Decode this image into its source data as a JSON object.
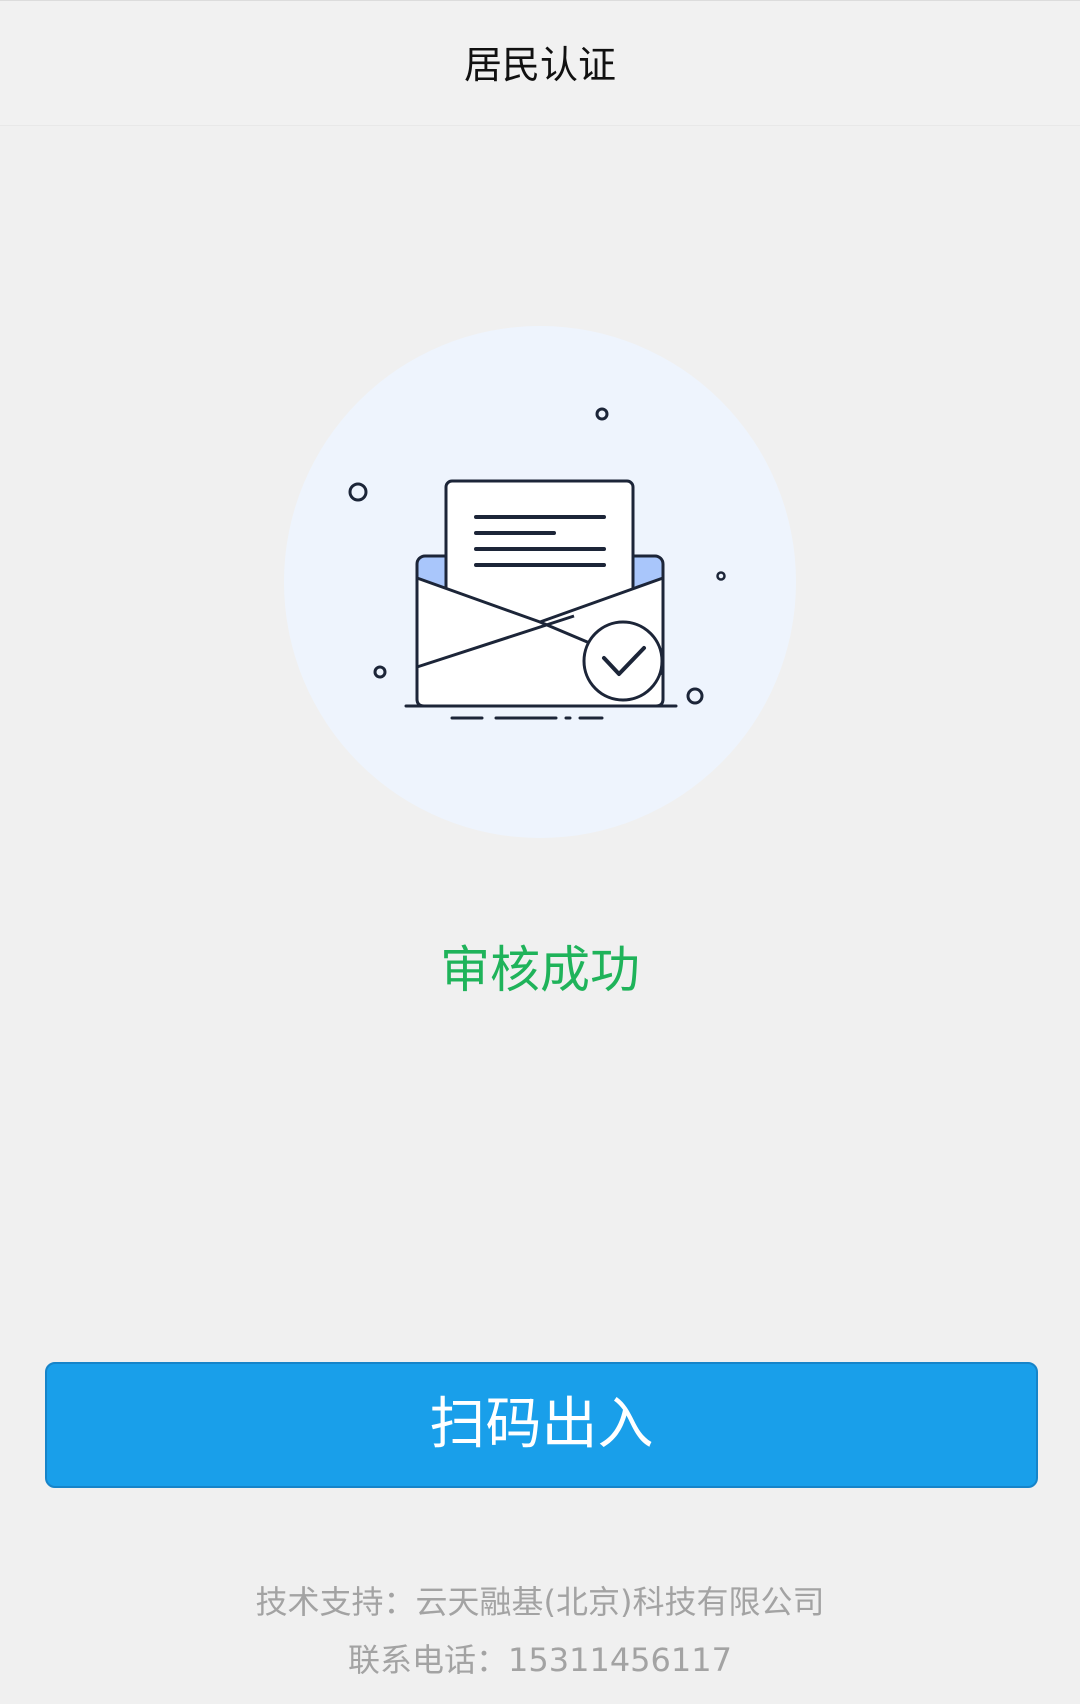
{
  "header": {
    "title": "居民认证"
  },
  "illustration": {
    "icon": "envelope-check-icon",
    "circle_color": "#eef4fd",
    "outline_color": "#1c2538",
    "accent_color": "#a9c6fb"
  },
  "status": {
    "text": "审核成功",
    "color": "#1fb35a"
  },
  "action": {
    "scan_label": "扫码出入",
    "color": "#199fea"
  },
  "footer": {
    "support": "技术支持：云天融基(北京)科技有限公司",
    "phone": "联系电话：15311456117"
  }
}
